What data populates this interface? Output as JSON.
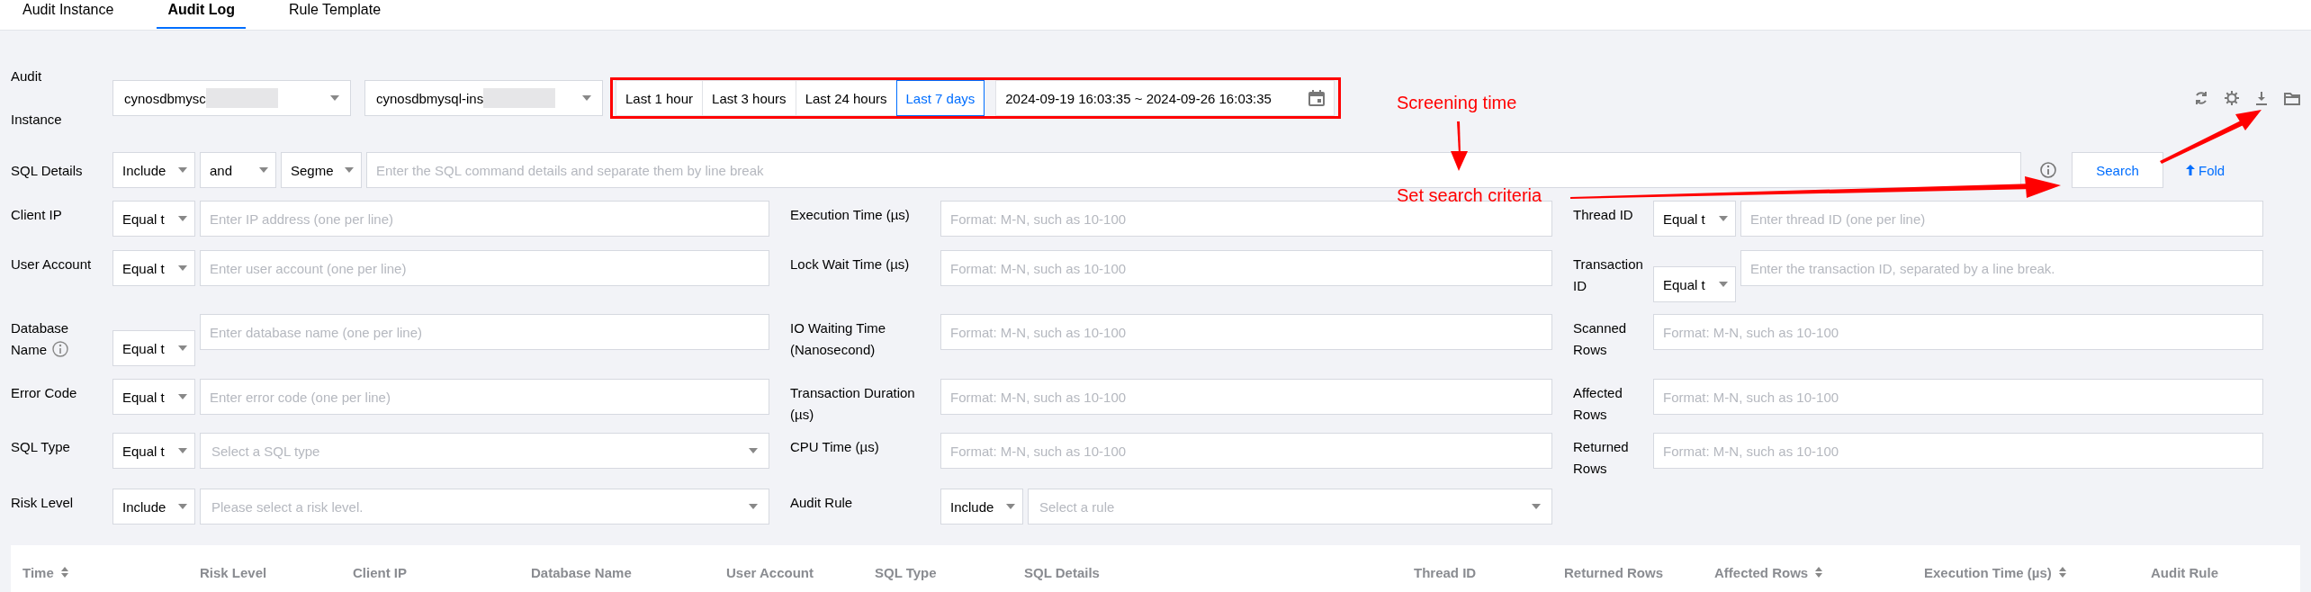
{
  "tabs": [
    {
      "label": "Audit Instance",
      "selected": false
    },
    {
      "label": "Audit Log",
      "selected": true
    },
    {
      "label": "Rule Template",
      "selected": false
    }
  ],
  "instance": {
    "label": "Audit Instance",
    "selects": [
      {
        "value": "cynosdbmysc",
        "redacted": true
      },
      {
        "value": "cynosdbmysql-ins",
        "redacted": true
      }
    ]
  },
  "time_range": {
    "presets": [
      {
        "label": "Last 1 hour",
        "selected": false
      },
      {
        "label": "Last 3 hours",
        "selected": false
      },
      {
        "label": "Last 24 hours",
        "selected": false
      },
      {
        "label": "Last 7 days",
        "selected": true
      }
    ],
    "range": "2024-09-19 16:03:35 ~ 2024-09-26 16:03:35"
  },
  "sql_details": {
    "label": "SQL Details",
    "operators": [
      "Include",
      "and",
      "Segme"
    ],
    "placeholder": "Enter the SQL command details and separate them by line break",
    "search_button": "Search",
    "fold_link": "Fold"
  },
  "filter_columns": [
    {
      "filters": [
        {
          "label": "Client IP",
          "operator": "Equal t",
          "kind": "text",
          "placeholder": "Enter IP address (one per line)"
        },
        {
          "label": "User Account",
          "operator": "Equal t",
          "kind": "text",
          "placeholder": "Enter user account (one per line)"
        },
        {
          "label": "Database Name",
          "info": true,
          "operator": "Equal t",
          "kind": "text",
          "placeholder": "Enter database name (one per line)"
        },
        {
          "label": "Error Code",
          "operator": "Equal t",
          "kind": "text",
          "placeholder": "Enter error code (one per line)"
        },
        {
          "label": "SQL Type",
          "operator": "Equal t",
          "kind": "select",
          "placeholder": "Select a SQL type"
        },
        {
          "label": "Risk Level",
          "operator": "Include",
          "kind": "select",
          "placeholder": "Please select a risk level."
        }
      ]
    },
    {
      "filters": [
        {
          "label": "Execution Time (µs)",
          "kind": "text",
          "placeholder": "Format: M-N, such as 10-100"
        },
        {
          "label": "Lock Wait Time (µs)",
          "kind": "text",
          "placeholder": "Format: M-N, such as 10-100"
        },
        {
          "label": "IO Waiting Time (Nanosecond)",
          "kind": "text",
          "placeholder": "Format: M-N, such as 10-100"
        },
        {
          "label": "Transaction Duration (µs)",
          "kind": "text",
          "placeholder": "Format: M-N, such as 10-100"
        },
        {
          "label": "CPU Time (µs)",
          "kind": "text",
          "placeholder": "Format: M-N, such as 10-100"
        },
        {
          "label": "Audit Rule",
          "operator": "Include",
          "kind": "select",
          "placeholder": "Select a rule"
        }
      ]
    },
    {
      "filters": [
        {
          "label": "Thread ID",
          "operator": "Equal t",
          "kind": "text",
          "placeholder": "Enter thread ID (one per line)"
        },
        {
          "label": "Transaction ID",
          "operator": "Equal t",
          "kind": "text",
          "placeholder": "Enter the transaction ID, separated by a line break."
        },
        {
          "label": "Scanned Rows",
          "kind": "text",
          "placeholder": "Format: M-N, such as 10-100"
        },
        {
          "label": "Affected Rows",
          "kind": "text",
          "placeholder": "Format: M-N, such as 10-100"
        },
        {
          "label": "Returned Rows",
          "kind": "text",
          "placeholder": "Format: M-N, such as 10-100"
        }
      ]
    }
  ],
  "annotations": [
    {
      "text": "Screening time"
    },
    {
      "text": "Set search criteria"
    }
  ],
  "table": {
    "columns": [
      {
        "label": "Time",
        "sortable": true
      },
      {
        "label": "Risk Level"
      },
      {
        "label": "Client IP"
      },
      {
        "label": "Database Name"
      },
      {
        "label": "User Account"
      },
      {
        "label": "SQL Type"
      },
      {
        "label": "SQL Details"
      },
      {
        "label": "Thread ID"
      },
      {
        "label": "Returned Rows"
      },
      {
        "label": "Affected Rows",
        "sortable": true
      },
      {
        "label": "Execution Time (µs)",
        "sortable": true
      },
      {
        "label": "Audit Rule"
      }
    ]
  }
}
